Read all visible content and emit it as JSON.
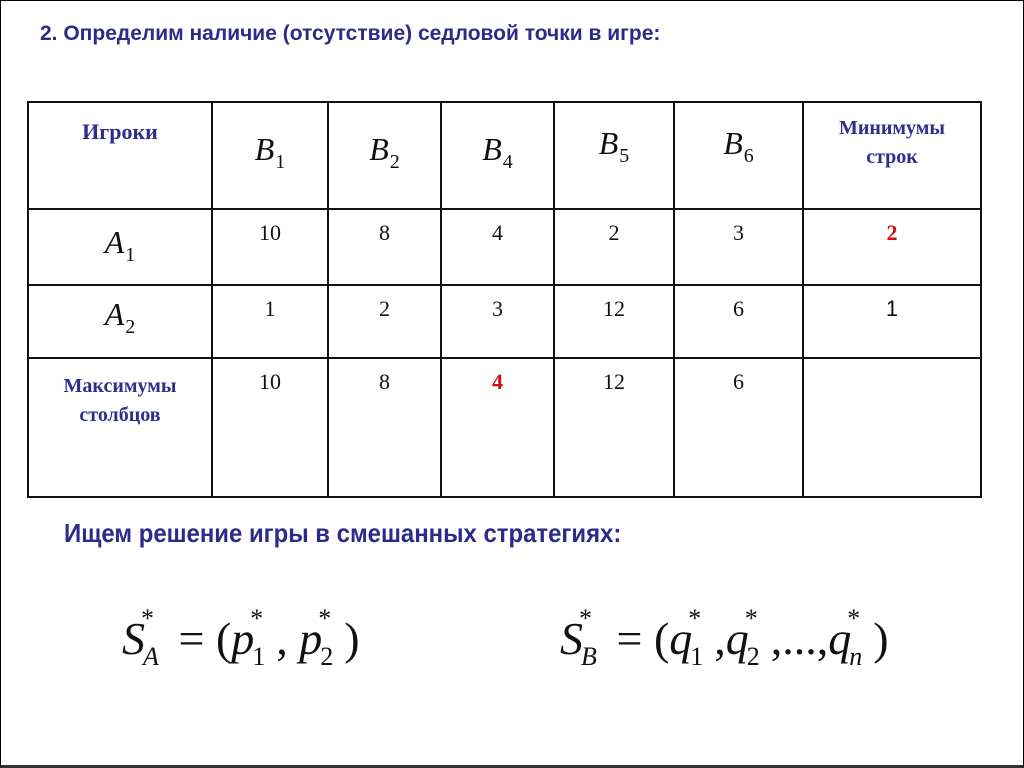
{
  "title": "2. Определим наличие (отсутствие) седловой точки в игре:",
  "table": {
    "corner_label": "Игроки",
    "columns": [
      {
        "letter": "B",
        "index": "1"
      },
      {
        "letter": "B",
        "index": "2"
      },
      {
        "letter": "B",
        "index": "4"
      },
      {
        "letter": "B",
        "index": "5"
      },
      {
        "letter": "B",
        "index": "6"
      }
    ],
    "min_header_line1": "Минимумы",
    "min_header_line2": "строк",
    "rows": [
      {
        "letter": "A",
        "index": "1",
        "values": [
          "10",
          "8",
          "4",
          "2",
          "3"
        ],
        "row_min": "2",
        "row_min_highlight": true
      },
      {
        "letter": "A",
        "index": "2",
        "values": [
          "1",
          "2",
          "3",
          "12",
          "6"
        ],
        "row_min": "1",
        "row_min_highlight": false
      }
    ],
    "max_label_line1": "Максимумы",
    "max_label_line2": "столбцов",
    "col_max": [
      "10",
      "8",
      "4",
      "12",
      "6"
    ],
    "col_max_highlight_index": 2,
    "highlight_color": "#cc1111",
    "header_color": "#2e2e8c"
  },
  "subtitle": "Ищем решение игры в смешанных стратегиях:",
  "formula_a": {
    "lhs": "S",
    "lhs_sub": "A",
    "star": "*",
    "eq": "=",
    "open": "(",
    "close": ")",
    "sep": ",",
    "terms": [
      {
        "v": "p",
        "i": "1"
      },
      {
        "v": "p",
        "i": "2"
      }
    ]
  },
  "formula_b": {
    "lhs": "S",
    "lhs_sub": "B",
    "star": "*",
    "eq": "=",
    "open": "(",
    "close": ")",
    "sep": ",",
    "ellipsis": ",...,",
    "terms": [
      {
        "v": "q",
        "i": "1"
      },
      {
        "v": "q",
        "i": "2"
      },
      {
        "v": "q",
        "i": "n"
      }
    ]
  }
}
